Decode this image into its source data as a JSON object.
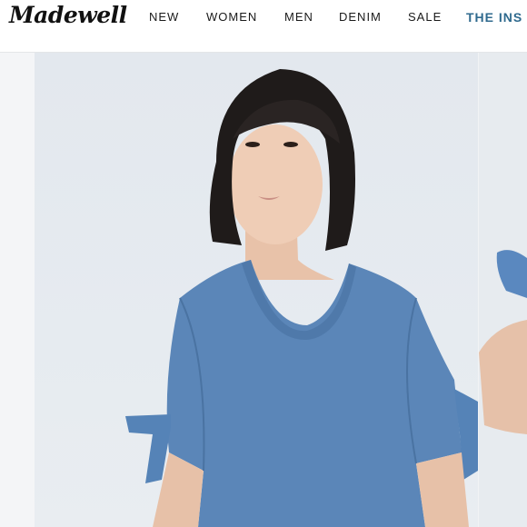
{
  "brand": {
    "logo_text": "Madewell"
  },
  "nav": {
    "items": [
      {
        "label": "NEW"
      },
      {
        "label": "WOMEN"
      },
      {
        "label": "MEN"
      },
      {
        "label": "DENIM"
      },
      {
        "label": "SALE"
      },
      {
        "label": "THE INS"
      }
    ]
  },
  "colors": {
    "accent_nav": "#2f6a8e",
    "denim": "#5b86b8",
    "background": "#e5e9ee"
  },
  "hero": {
    "image_subject": "model-wearing-denim-tie-sleeve-top"
  },
  "carousel": {
    "next_slide_visible": true
  }
}
